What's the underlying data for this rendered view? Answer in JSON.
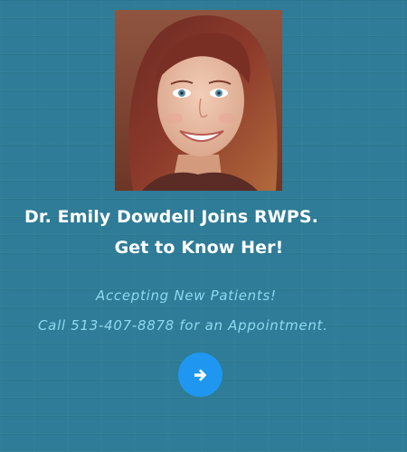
{
  "announcement": {
    "headline_line1": "Dr. Emily Dowdell Joins RWPS.",
    "headline_line2": "Get to Know Her!",
    "tagline_line1": "Accepting New Patients!",
    "tagline_line2": "Call 513-407-8878 for an Appointment.",
    "cta_icon": "arrow-right-icon"
  },
  "colors": {
    "background": "#2e7c97",
    "headline": "#ffffff",
    "tagline": "#8fd8f2",
    "button": "#1f97f0"
  }
}
